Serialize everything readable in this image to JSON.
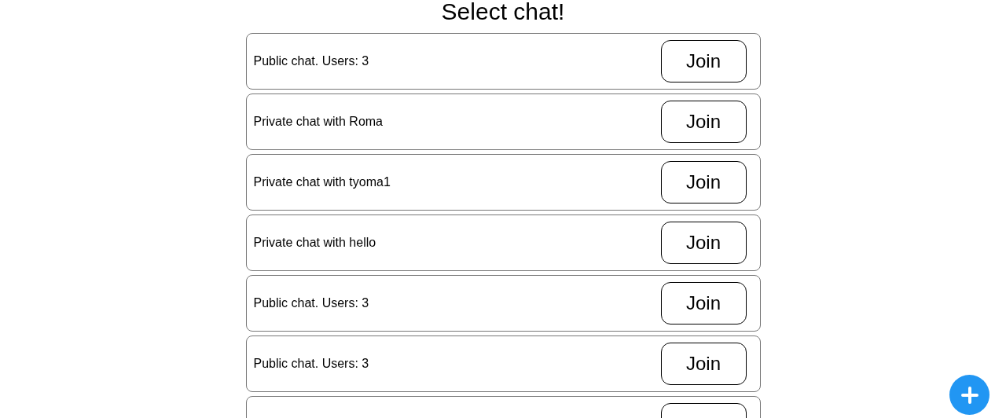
{
  "title": "Select chat!",
  "chats": [
    {
      "kind": "chat",
      "label": "Public chat. Users: 3",
      "button": "Join"
    },
    {
      "kind": "chat",
      "label": "Private chat with Roma",
      "button": "Join"
    },
    {
      "kind": "chat",
      "label": "Private chat with tyoma1",
      "button": "Join"
    },
    {
      "kind": "chat",
      "label": "Private chat with hello",
      "button": "Join"
    },
    {
      "kind": "chat",
      "label": "Public chat. Users: 3",
      "button": "Join"
    },
    {
      "kind": "chat",
      "label": "Public chat. Users: 3",
      "button": "Join"
    },
    {
      "kind": "partial"
    }
  ],
  "fab": {
    "kind": "add"
  }
}
